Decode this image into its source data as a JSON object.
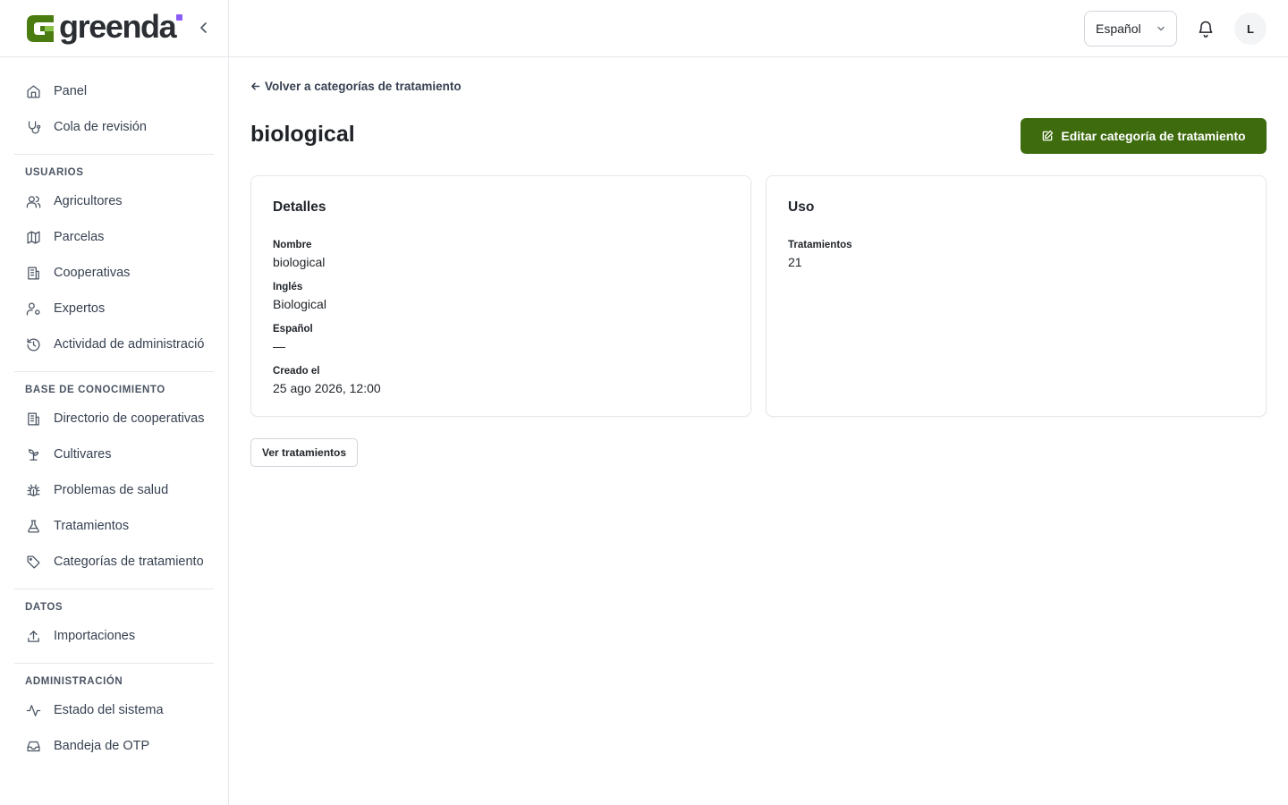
{
  "brand": {
    "name": "greenda",
    "accent": "#3d6b0d",
    "dot_color": "#8b5cf6"
  },
  "sidebar": {
    "top_items": [
      {
        "label": "Panel",
        "icon": "home-icon"
      },
      {
        "label": "Cola de revisión",
        "icon": "stethoscope-icon"
      }
    ],
    "sections": [
      {
        "title": "USUARIOS",
        "items": [
          {
            "label": "Agricultores",
            "icon": "users-icon"
          },
          {
            "label": "Parcelas",
            "icon": "map-icon"
          },
          {
            "label": "Cooperativas",
            "icon": "building-icon"
          },
          {
            "label": "Expertos",
            "icon": "user-cog-icon"
          },
          {
            "label": "Actividad de administración",
            "icon": "history-icon"
          }
        ]
      },
      {
        "title": "BASE DE CONOCIMIENTO",
        "items": [
          {
            "label": "Directorio de cooperativas",
            "icon": "building-icon"
          },
          {
            "label": "Cultivares",
            "icon": "sprout-icon"
          },
          {
            "label": "Problemas de salud",
            "icon": "bug-icon"
          },
          {
            "label": "Tratamientos",
            "icon": "flask-icon"
          },
          {
            "label": "Categorías de tratamiento",
            "icon": "tag-icon"
          }
        ]
      },
      {
        "title": "DATOS",
        "items": [
          {
            "label": "Importaciones",
            "icon": "upload-icon"
          }
        ]
      },
      {
        "title": "ADMINISTRACIÓN",
        "items": [
          {
            "label": "Estado del sistema",
            "icon": "activity-icon"
          },
          {
            "label": "Bandeja de OTP",
            "icon": "inbox-icon"
          }
        ]
      }
    ]
  },
  "topbar": {
    "language": "Español",
    "avatar_initial": "L"
  },
  "main": {
    "back_label": "Volver a categorías de tratamiento",
    "title": "biological",
    "edit_label": "Editar categoría de tratamiento",
    "details": {
      "heading": "Detalles",
      "fields": [
        {
          "key": "Nombre",
          "value": "biological"
        },
        {
          "key": "Inglés",
          "value": "Biological"
        },
        {
          "key": "Español",
          "value": "—"
        },
        {
          "key": "Creado el",
          "value": "25 ago 2026, 12:00"
        }
      ]
    },
    "usage": {
      "heading": "Uso",
      "fields": [
        {
          "key": "Tratamientos",
          "value": "21"
        }
      ]
    },
    "view_treatments_label": "Ver tratamientos"
  }
}
